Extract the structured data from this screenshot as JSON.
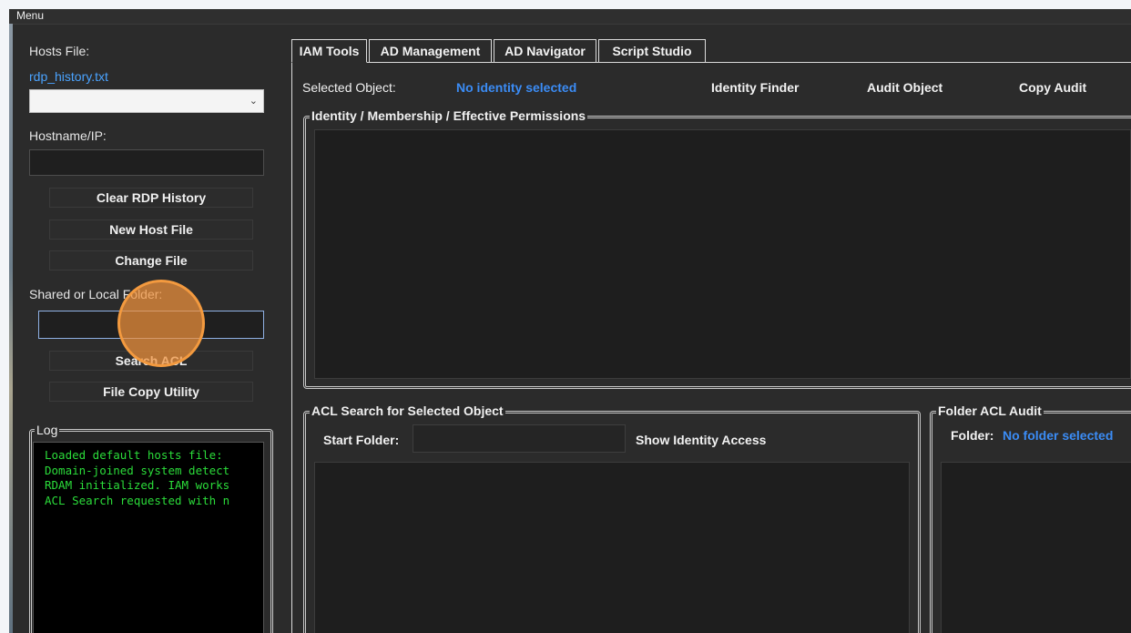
{
  "menu": {
    "label": "Menu"
  },
  "left": {
    "hosts_file_label": "Hosts File:",
    "hosts_file_name": "rdp_history.txt",
    "hosts_combo_value": "",
    "hostname_label": "Hostname/IP:",
    "hostname_value": "",
    "buttons": {
      "clear_history": "Clear RDP History",
      "new_host_file": "New Host File",
      "change_file": "Change File",
      "search_acl": "Search ACL",
      "file_copy": "File Copy Utility"
    },
    "folder_label": "Shared or Local Folder:",
    "folder_value": ""
  },
  "log": {
    "title": "Log",
    "lines": [
      "Loaded default hosts file:",
      "Domain-joined system detect",
      "RDAM initialized. IAM works",
      "ACL Search requested with n"
    ]
  },
  "tabs": [
    {
      "label": "IAM Tools",
      "active": true
    },
    {
      "label": "AD Management",
      "active": false
    },
    {
      "label": "AD Navigator",
      "active": false
    },
    {
      "label": "Script Studio",
      "active": false
    }
  ],
  "iam": {
    "selected_object_label": "Selected Object:",
    "selected_object_value": "No identity selected",
    "identity_finder": "Identity Finder",
    "audit_object": "Audit Object",
    "copy_audit": "Copy Audit",
    "identity_group_title": "Identity / Membership / Effective Permissions",
    "acl_group_title": "ACL Search for Selected Object",
    "start_folder_label": "Start Folder:",
    "start_folder_value": "",
    "show_identity_access": "Show Identity Access",
    "folder_audit_title": "Folder ACL Audit",
    "folder_label": "Folder:",
    "folder_value": "No folder selected"
  },
  "colors": {
    "accent_link": "#4aa3ff",
    "accent_value": "#3b8cf5",
    "log_text": "#2bdc3a",
    "click_marker": "#f39a3f"
  }
}
